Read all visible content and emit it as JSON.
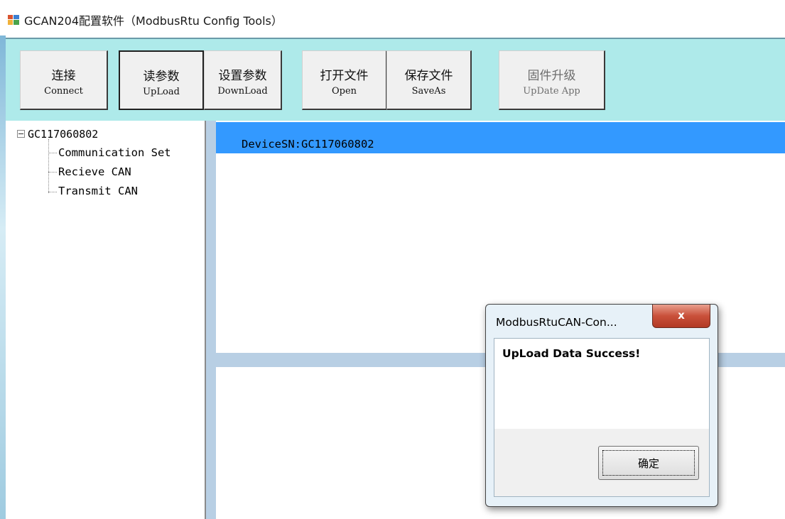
{
  "window": {
    "title": "GCAN204配置软件（ModbusRtu Config Tools）",
    "icon": "app-window-icon"
  },
  "toolbar": {
    "buttons": [
      {
        "cn": "连接",
        "en": "Connect"
      },
      {
        "cn": "读参数",
        "en": "UpLoad"
      },
      {
        "cn": "设置参数",
        "en": "DownLoad"
      },
      {
        "cn": "打开文件",
        "en": "Open"
      },
      {
        "cn": "保存文件",
        "en": "SaveAs"
      },
      {
        "cn": "固件升级",
        "en": "UpDate App"
      }
    ]
  },
  "tree": {
    "root": "GC117060802",
    "items": [
      "Communication Set",
      "Recieve CAN",
      "Transmit CAN"
    ]
  },
  "main": {
    "selected_row": "DeviceSN:GC117060802"
  },
  "dialog": {
    "title": "ModbusRtuCAN-Con...",
    "close_glyph": "x",
    "message": "UpLoad Data Success!",
    "ok_label": "确定"
  },
  "colors": {
    "toolbar_bg": "#aeeaea",
    "selection": "#3399ff",
    "splitter": "#b8cfe4"
  }
}
